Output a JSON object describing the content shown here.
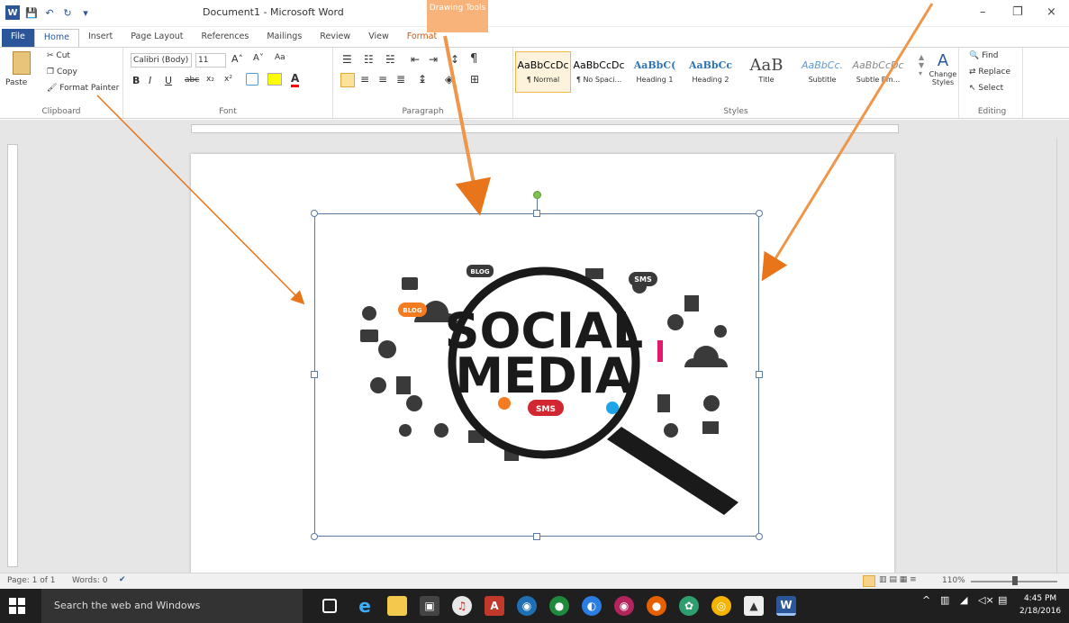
{
  "app": {
    "title": "Document1 - Microsoft Word",
    "contextual_tab_group": "Drawing Tools",
    "contextual_tab": "Format",
    "logo_letter": "W"
  },
  "window_controls": [
    "–",
    "❐",
    "×"
  ],
  "tabs": [
    "File",
    "Home",
    "Insert",
    "Page Layout",
    "References",
    "Mailings",
    "Review",
    "View"
  ],
  "clipboard": {
    "group": "Clipboard",
    "paste": "Paste",
    "cut": "Cut",
    "copy": "Copy",
    "format_painter": "Format Painter"
  },
  "font": {
    "group": "Font",
    "name": "Calibri (Body)",
    "size": "11",
    "bold": "B",
    "italic": "I",
    "underline": "U",
    "strike": "abc",
    "subscript": "x₂",
    "superscript": "x²",
    "grow": "A˄",
    "shrink": "A˅",
    "case": "Aa",
    "color": "A"
  },
  "paragraph": {
    "group": "Paragraph",
    "pilcrow": "¶"
  },
  "styles": {
    "group": "Styles",
    "items": [
      {
        "preview": "AaBbCcDc",
        "name": "¶ Normal"
      },
      {
        "preview": "AaBbCcDc",
        "name": "¶ No Spaci..."
      },
      {
        "preview": "AaBbC(",
        "name": "Heading 1"
      },
      {
        "preview": "AaBbCc",
        "name": "Heading 2"
      },
      {
        "preview": "AaB",
        "name": "Title"
      },
      {
        "preview": "AaBbCc.",
        "name": "Subtitle"
      },
      {
        "preview": "AaBbCcDc",
        "name": "Subtle Em..."
      }
    ],
    "change_styles": "Change Styles"
  },
  "editing": {
    "group": "Editing",
    "find": "Find",
    "replace": "Replace",
    "select": "Select"
  },
  "image": {
    "line1": "SOCIAL",
    "line2": "MEDIA",
    "badges": [
      "BLOG",
      "SMS",
      "BLOG",
      "SMS"
    ]
  },
  "status": {
    "page": "Page: 1 of 1",
    "words": "Words: 0",
    "zoom": "110%"
  },
  "taskbar": {
    "search_placeholder": "Search the web and Windows",
    "time": "4:45 PM",
    "date": "2/18/2016"
  },
  "colors": {
    "word_blue": "#2b579a",
    "drawing_tools": "#f8b37a",
    "arrow": "#e8751a",
    "taskbar": "#1f1f1f"
  }
}
